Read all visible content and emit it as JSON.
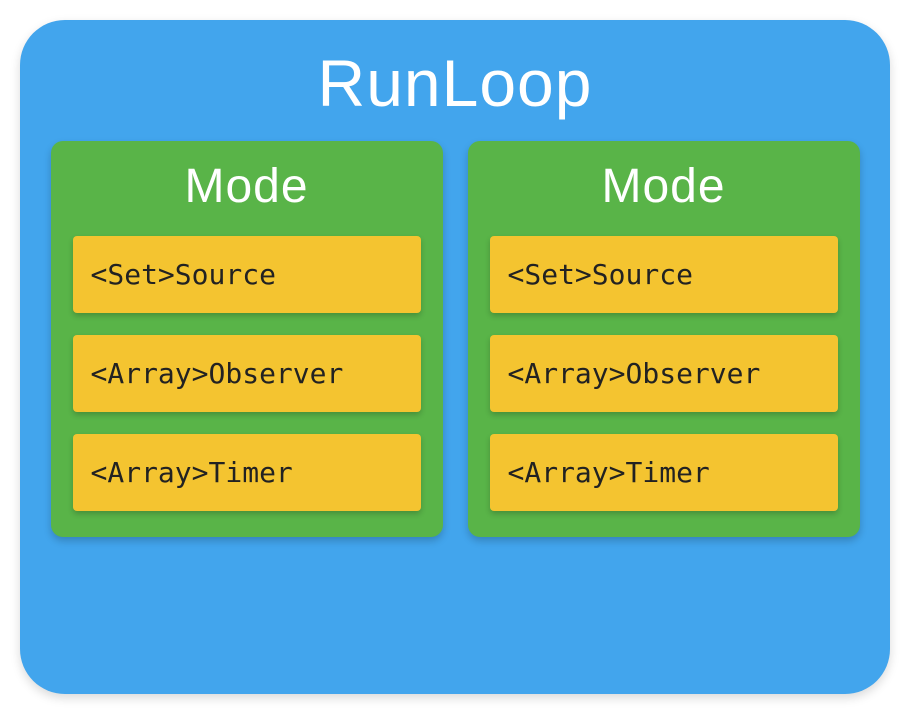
{
  "runloop": {
    "title": "RunLoop",
    "modes": [
      {
        "title": "Mode",
        "items": [
          {
            "label": "<Set>Source"
          },
          {
            "label": "<Array>Observer"
          },
          {
            "label": "<Array>Timer"
          }
        ]
      },
      {
        "title": "Mode",
        "items": [
          {
            "label": "<Set>Source"
          },
          {
            "label": "<Array>Observer"
          },
          {
            "label": "<Array>Timer"
          }
        ]
      }
    ]
  },
  "colors": {
    "runloop_bg": "#42a5ed",
    "mode_bg": "#59b448",
    "item_bg": "#f4c430",
    "title_text": "#ffffff",
    "item_text": "#222222"
  }
}
